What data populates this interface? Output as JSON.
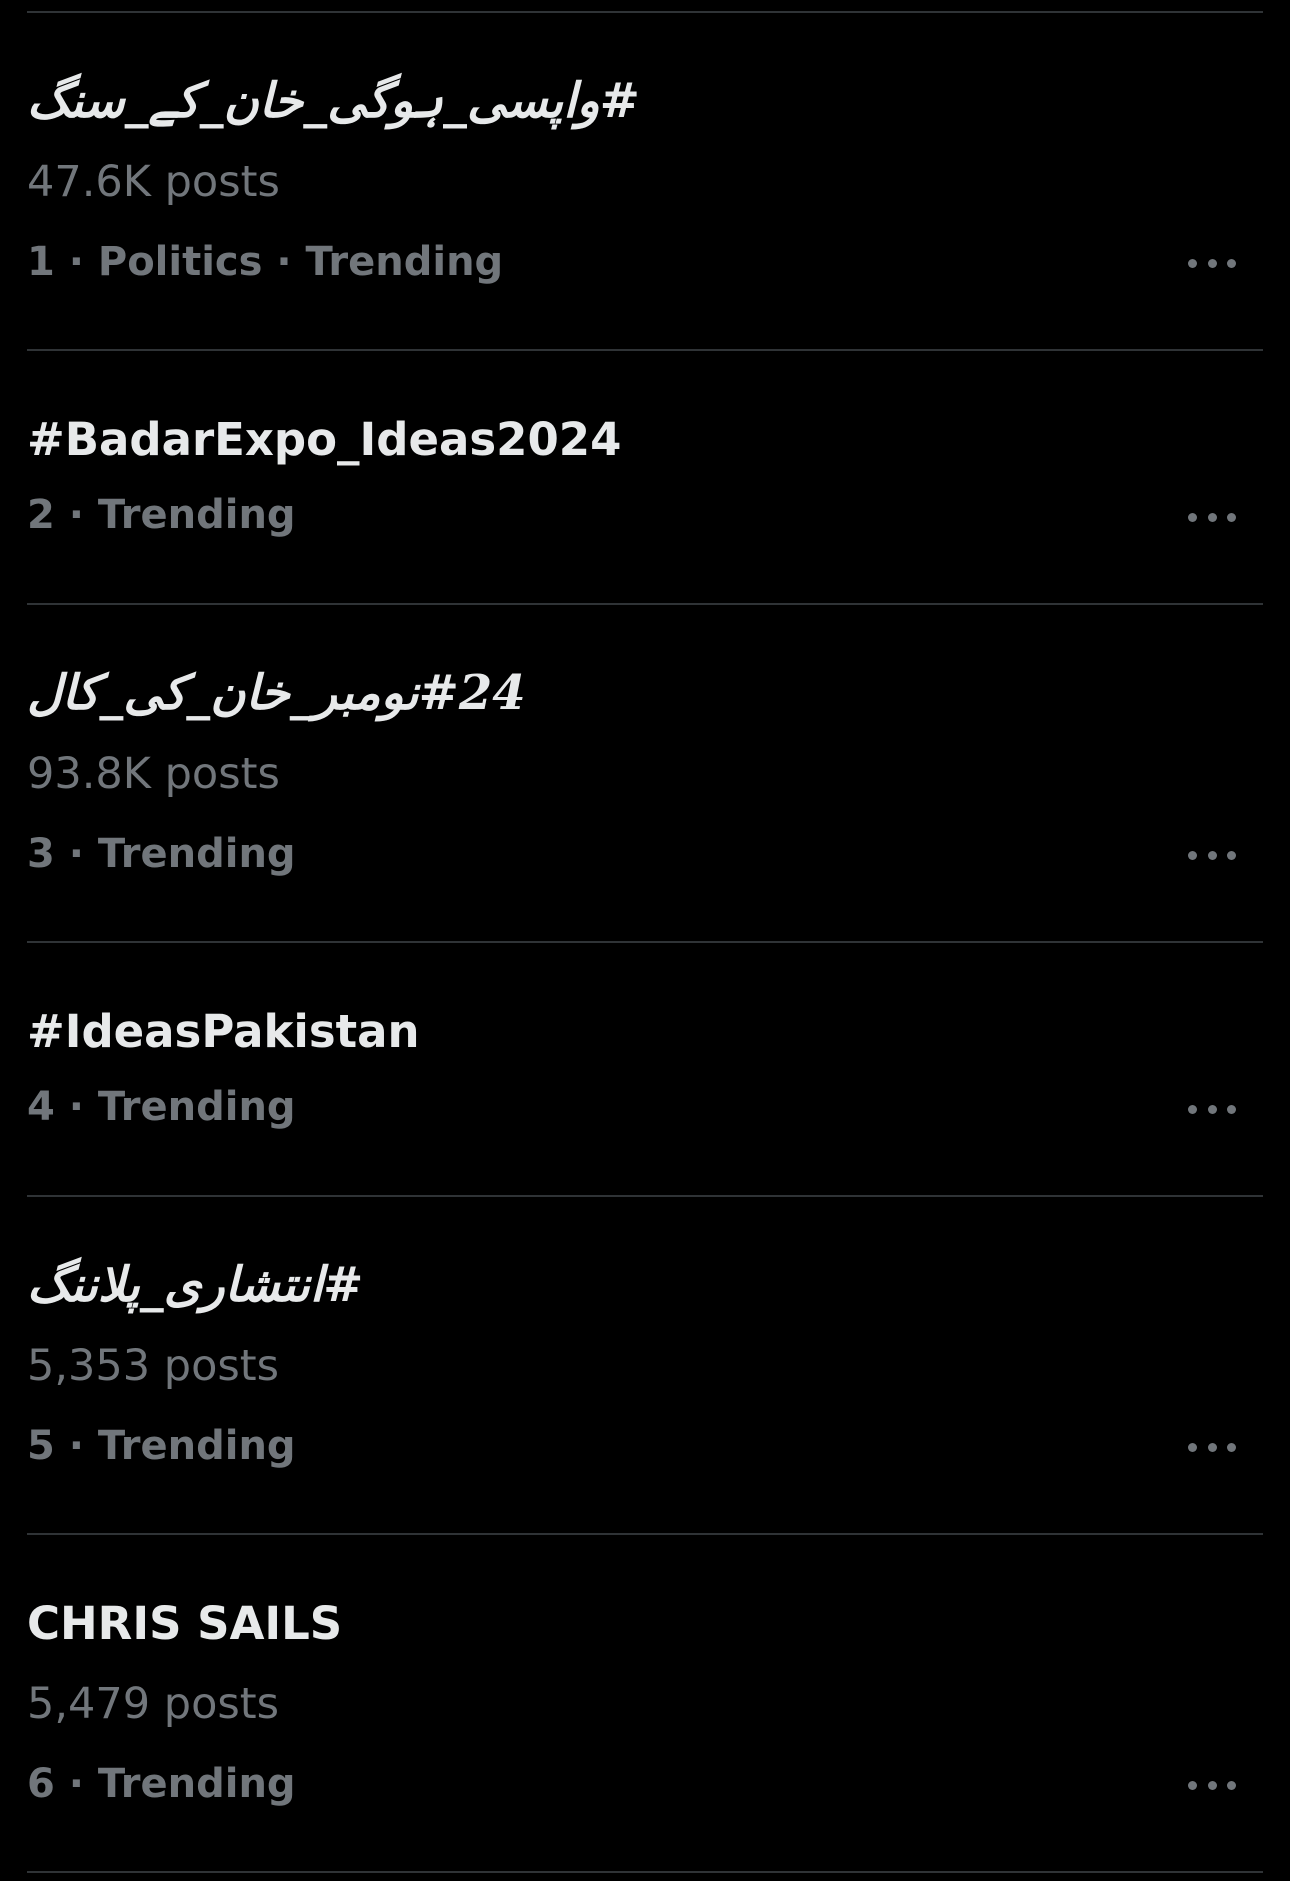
{
  "trends": [
    {
      "title": "#واپسی_ہوگی_خان_کے_سنگ",
      "posts": "47.6K posts",
      "meta": "1 · Politics · Trending",
      "more_icon": "more-horizontal-icon"
    },
    {
      "title": "#BadarExpo_Ideas2024",
      "posts": "",
      "meta": "2 · Trending",
      "more_icon": "more-horizontal-icon"
    },
    {
      "title": "#24نومبر_خان_کی_کال",
      "posts": "93.8K posts",
      "meta": "3 · Trending",
      "more_icon": "more-horizontal-icon"
    },
    {
      "title": "#IdeasPakistan",
      "posts": "",
      "meta": "4 · Trending",
      "more_icon": "more-horizontal-icon"
    },
    {
      "title": "#انتشاری_پلاننگ",
      "posts": "5,353 posts",
      "meta": "5 · Trending",
      "more_icon": "more-horizontal-icon"
    },
    {
      "title": "CHRIS SAILS",
      "posts": "5,479 posts",
      "meta": "6 · Trending",
      "more_icon": "more-horizontal-icon"
    }
  ],
  "colors": {
    "background": "#000000",
    "primary_text": "#e7e9ea",
    "secondary_text": "#71767b",
    "divider": "#2f3336"
  }
}
